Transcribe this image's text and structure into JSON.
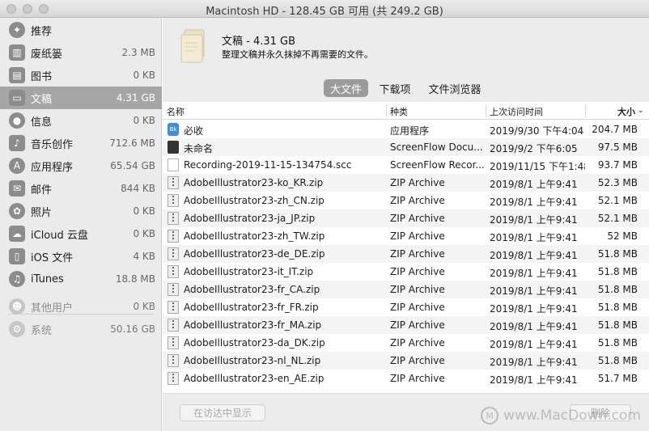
{
  "window": {
    "title": "Macintosh HD - 128.45 GB 可用 (共 249.2 GB)"
  },
  "sidebar": {
    "items": [
      {
        "label": "推荐",
        "size": "",
        "icon": "lightbulb-icon",
        "selected": false,
        "dim": false
      },
      {
        "label": "废纸篓",
        "size": "2.3 MB",
        "icon": "trash-icon",
        "selected": false,
        "dim": false
      },
      {
        "label": "图书",
        "size": "0 KB",
        "icon": "book-icon",
        "selected": false,
        "dim": false
      },
      {
        "label": "文稿",
        "size": "4.31 GB",
        "icon": "document-icon",
        "selected": true,
        "dim": false
      },
      {
        "label": "信息",
        "size": "0 KB",
        "icon": "message-icon",
        "selected": false,
        "dim": false
      },
      {
        "label": "音乐创作",
        "size": "712.6 MB",
        "icon": "guitar-icon",
        "selected": false,
        "dim": false
      },
      {
        "label": "应用程序",
        "size": "65.54 GB",
        "icon": "app-store-icon",
        "selected": false,
        "dim": false
      },
      {
        "label": "邮件",
        "size": "844 KB",
        "icon": "mail-icon",
        "selected": false,
        "dim": false
      },
      {
        "label": "照片",
        "size": "0 KB",
        "icon": "photos-icon",
        "selected": false,
        "dim": false
      },
      {
        "label": "iCloud 云盘",
        "size": "0 KB",
        "icon": "cloud-icon",
        "selected": false,
        "dim": false
      },
      {
        "label": "iOS 文件",
        "size": "4 KB",
        "icon": "phone-icon",
        "selected": false,
        "dim": false
      },
      {
        "label": "iTunes",
        "size": "18.8 MB",
        "icon": "music-note-icon",
        "selected": false,
        "dim": false
      },
      {
        "label": "其他用户",
        "size": "0 KB",
        "icon": "users-icon",
        "selected": false,
        "dim": true
      },
      {
        "label": "系统",
        "size": "50.16 GB",
        "icon": "system-gear-icon",
        "selected": false,
        "dim": true
      }
    ]
  },
  "header": {
    "title": "文稿 - 4.31 GB",
    "description": "整理文稿并永久抹掉不再需要的文件。"
  },
  "tabs": [
    {
      "label": "大文件",
      "active": true
    },
    {
      "label": "下载项",
      "active": false
    },
    {
      "label": "文件浏览器",
      "active": false
    }
  ],
  "table": {
    "columns": {
      "name": "名称",
      "kind": "种类",
      "last_opened": "上次访问时间",
      "size": "大小"
    },
    "rows": [
      {
        "icon": "app",
        "name": "必收",
        "kind": "应用程序",
        "date": "2019/9/30 下午4:04",
        "size": "204.7 MB"
      },
      {
        "icon": "sf",
        "name": "未命名",
        "kind": "ScreenFlow Docu...",
        "date": "2019/9/2 下午6:05",
        "size": "97.5 MB"
      },
      {
        "icon": "doc",
        "name": "Recording-2019-11-15-134754.scc",
        "kind": "ScreenFlow Recor...",
        "date": "2019/11/15 下午1:48",
        "size": "93.7 MB"
      },
      {
        "icon": "zip",
        "name": "AdobeIllustrator23-ko_KR.zip",
        "kind": "ZIP Archive",
        "date": "2019/8/1 上午9:41",
        "size": "52.3 MB"
      },
      {
        "icon": "zip",
        "name": "AdobeIllustrator23-zh_CN.zip",
        "kind": "ZIP Archive",
        "date": "2019/8/1 上午9:41",
        "size": "52.1 MB"
      },
      {
        "icon": "zip",
        "name": "AdobeIllustrator23-ja_JP.zip",
        "kind": "ZIP Archive",
        "date": "2019/8/1 上午9:41",
        "size": "52.1 MB"
      },
      {
        "icon": "zip",
        "name": "AdobeIllustrator23-zh_TW.zip",
        "kind": "ZIP Archive",
        "date": "2019/8/1 上午9:41",
        "size": "52 MB"
      },
      {
        "icon": "zip",
        "name": "AdobeIllustrator23-de_DE.zip",
        "kind": "ZIP Archive",
        "date": "2019/8/1 上午9:41",
        "size": "51.8 MB"
      },
      {
        "icon": "zip",
        "name": "AdobeIllustrator23-it_IT.zip",
        "kind": "ZIP Archive",
        "date": "2019/8/1 上午9:41",
        "size": "51.8 MB"
      },
      {
        "icon": "zip",
        "name": "AdobeIllustrator23-fr_CA.zip",
        "kind": "ZIP Archive",
        "date": "2019/8/1 上午9:41",
        "size": "51.8 MB"
      },
      {
        "icon": "zip",
        "name": "AdobeIllustrator23-fr_FR.zip",
        "kind": "ZIP Archive",
        "date": "2019/8/1 上午9:41",
        "size": "51.8 MB"
      },
      {
        "icon": "zip",
        "name": "AdobeIllustrator23-fr_MA.zip",
        "kind": "ZIP Archive",
        "date": "2019/8/1 上午9:41",
        "size": "51.8 MB"
      },
      {
        "icon": "zip",
        "name": "AdobeIllustrator23-da_DK.zip",
        "kind": "ZIP Archive",
        "date": "2019/8/1 上午9:41",
        "size": "51.8 MB"
      },
      {
        "icon": "zip",
        "name": "AdobeIllustrator23-nl_NL.zip",
        "kind": "ZIP Archive",
        "date": "2019/8/1 上午9:41",
        "size": "51.8 MB"
      },
      {
        "icon": "zip",
        "name": "AdobeIllustrator23-en_AE.zip",
        "kind": "ZIP Archive",
        "date": "2019/8/1 上午9:41",
        "size": "51.7 MB"
      }
    ]
  },
  "footer": {
    "reveal_button": "在访达中显示",
    "delete_button": "删除"
  },
  "watermark": {
    "text": "www.MacDown.com"
  }
}
